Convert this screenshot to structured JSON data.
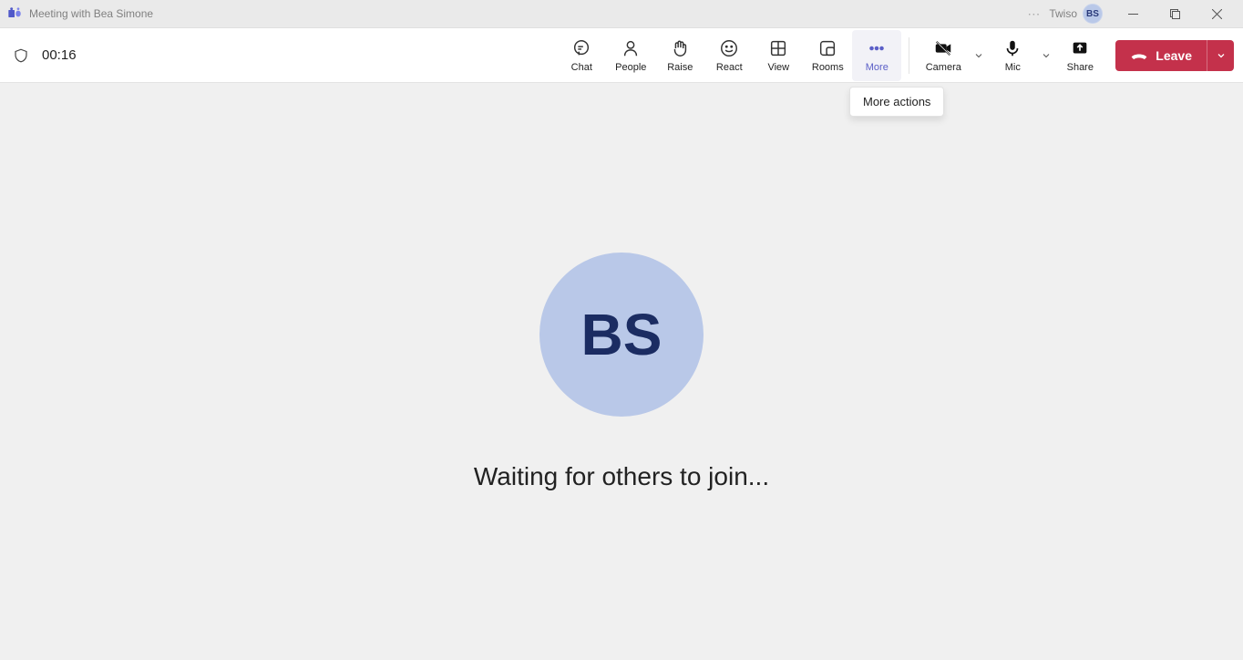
{
  "titlebar": {
    "title": "Meeting with Bea Simone",
    "organization": "Twiso",
    "avatar_initials": "BS"
  },
  "toolbar": {
    "timer": "00:16",
    "buttons": {
      "chat": "Chat",
      "people": "People",
      "raise": "Raise",
      "react": "React",
      "view": "View",
      "rooms": "Rooms",
      "more": "More",
      "camera": "Camera",
      "mic": "Mic",
      "share": "Share"
    },
    "more_tooltip": "More actions",
    "leave": "Leave"
  },
  "content": {
    "avatar_initials": "BS",
    "waiting_text": "Waiting for others to join..."
  }
}
